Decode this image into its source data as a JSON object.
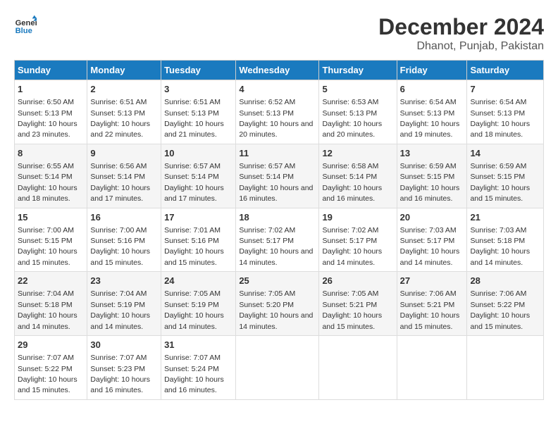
{
  "logo": {
    "line1": "General",
    "line2": "Blue"
  },
  "title": "December 2024",
  "subtitle": "Dhanot, Punjab, Pakistan",
  "days_of_week": [
    "Sunday",
    "Monday",
    "Tuesday",
    "Wednesday",
    "Thursday",
    "Friday",
    "Saturday"
  ],
  "weeks": [
    [
      {
        "day": "1",
        "sunrise": "6:50 AM",
        "sunset": "5:13 PM",
        "daylight": "10 hours and 23 minutes."
      },
      {
        "day": "2",
        "sunrise": "6:51 AM",
        "sunset": "5:13 PM",
        "daylight": "10 hours and 22 minutes."
      },
      {
        "day": "3",
        "sunrise": "6:51 AM",
        "sunset": "5:13 PM",
        "daylight": "10 hours and 21 minutes."
      },
      {
        "day": "4",
        "sunrise": "6:52 AM",
        "sunset": "5:13 PM",
        "daylight": "10 hours and 20 minutes."
      },
      {
        "day": "5",
        "sunrise": "6:53 AM",
        "sunset": "5:13 PM",
        "daylight": "10 hours and 20 minutes."
      },
      {
        "day": "6",
        "sunrise": "6:54 AM",
        "sunset": "5:13 PM",
        "daylight": "10 hours and 19 minutes."
      },
      {
        "day": "7",
        "sunrise": "6:54 AM",
        "sunset": "5:13 PM",
        "daylight": "10 hours and 18 minutes."
      }
    ],
    [
      {
        "day": "8",
        "sunrise": "6:55 AM",
        "sunset": "5:14 PM",
        "daylight": "10 hours and 18 minutes."
      },
      {
        "day": "9",
        "sunrise": "6:56 AM",
        "sunset": "5:14 PM",
        "daylight": "10 hours and 17 minutes."
      },
      {
        "day": "10",
        "sunrise": "6:57 AM",
        "sunset": "5:14 PM",
        "daylight": "10 hours and 17 minutes."
      },
      {
        "day": "11",
        "sunrise": "6:57 AM",
        "sunset": "5:14 PM",
        "daylight": "10 hours and 16 minutes."
      },
      {
        "day": "12",
        "sunrise": "6:58 AM",
        "sunset": "5:14 PM",
        "daylight": "10 hours and 16 minutes."
      },
      {
        "day": "13",
        "sunrise": "6:59 AM",
        "sunset": "5:15 PM",
        "daylight": "10 hours and 16 minutes."
      },
      {
        "day": "14",
        "sunrise": "6:59 AM",
        "sunset": "5:15 PM",
        "daylight": "10 hours and 15 minutes."
      }
    ],
    [
      {
        "day": "15",
        "sunrise": "7:00 AM",
        "sunset": "5:15 PM",
        "daylight": "10 hours and 15 minutes."
      },
      {
        "day": "16",
        "sunrise": "7:00 AM",
        "sunset": "5:16 PM",
        "daylight": "10 hours and 15 minutes."
      },
      {
        "day": "17",
        "sunrise": "7:01 AM",
        "sunset": "5:16 PM",
        "daylight": "10 hours and 15 minutes."
      },
      {
        "day": "18",
        "sunrise": "7:02 AM",
        "sunset": "5:17 PM",
        "daylight": "10 hours and 14 minutes."
      },
      {
        "day": "19",
        "sunrise": "7:02 AM",
        "sunset": "5:17 PM",
        "daylight": "10 hours and 14 minutes."
      },
      {
        "day": "20",
        "sunrise": "7:03 AM",
        "sunset": "5:17 PM",
        "daylight": "10 hours and 14 minutes."
      },
      {
        "day": "21",
        "sunrise": "7:03 AM",
        "sunset": "5:18 PM",
        "daylight": "10 hours and 14 minutes."
      }
    ],
    [
      {
        "day": "22",
        "sunrise": "7:04 AM",
        "sunset": "5:18 PM",
        "daylight": "10 hours and 14 minutes."
      },
      {
        "day": "23",
        "sunrise": "7:04 AM",
        "sunset": "5:19 PM",
        "daylight": "10 hours and 14 minutes."
      },
      {
        "day": "24",
        "sunrise": "7:05 AM",
        "sunset": "5:19 PM",
        "daylight": "10 hours and 14 minutes."
      },
      {
        "day": "25",
        "sunrise": "7:05 AM",
        "sunset": "5:20 PM",
        "daylight": "10 hours and 14 minutes."
      },
      {
        "day": "26",
        "sunrise": "7:05 AM",
        "sunset": "5:21 PM",
        "daylight": "10 hours and 15 minutes."
      },
      {
        "day": "27",
        "sunrise": "7:06 AM",
        "sunset": "5:21 PM",
        "daylight": "10 hours and 15 minutes."
      },
      {
        "day": "28",
        "sunrise": "7:06 AM",
        "sunset": "5:22 PM",
        "daylight": "10 hours and 15 minutes."
      }
    ],
    [
      {
        "day": "29",
        "sunrise": "7:07 AM",
        "sunset": "5:22 PM",
        "daylight": "10 hours and 15 minutes."
      },
      {
        "day": "30",
        "sunrise": "7:07 AM",
        "sunset": "5:23 PM",
        "daylight": "10 hours and 16 minutes."
      },
      {
        "day": "31",
        "sunrise": "7:07 AM",
        "sunset": "5:24 PM",
        "daylight": "10 hours and 16 minutes."
      },
      null,
      null,
      null,
      null
    ]
  ]
}
